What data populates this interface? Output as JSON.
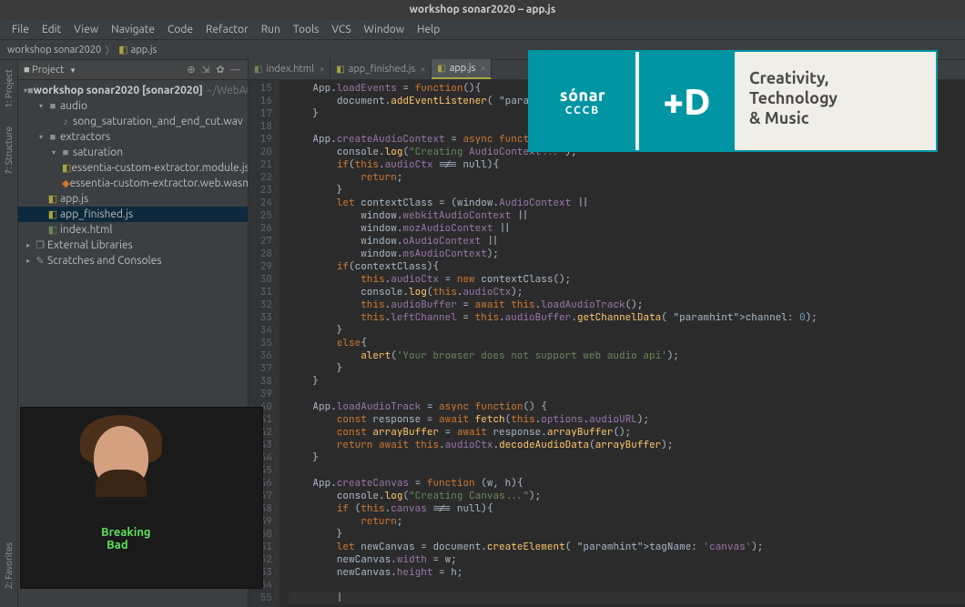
{
  "title": "workshop sonar2020 – app.js",
  "menu": [
    "File",
    "Edit",
    "View",
    "Navigate",
    "Code",
    "Refactor",
    "Run",
    "Tools",
    "VCS",
    "Window",
    "Help"
  ],
  "breadcrumb": {
    "project": "workshop sonar2020",
    "file": "app.js"
  },
  "leftbar": [
    "1: Project",
    "7: Structure",
    "2: Favorites"
  ],
  "project_panel": {
    "title": "Project"
  },
  "tree": [
    {
      "depth": 0,
      "caret": "▾",
      "icon": "dir",
      "label": "workshop sonar2020",
      "extra_bold": "[sonar2020]",
      "dim": "~/WebAudioPrj"
    },
    {
      "depth": 1,
      "caret": "▾",
      "icon": "dir",
      "label": "audio"
    },
    {
      "depth": 2,
      "caret": "",
      "icon": "wav",
      "label": "song_saturation_and_end_cut.wav"
    },
    {
      "depth": 1,
      "caret": "▾",
      "icon": "dir",
      "label": "extractors"
    },
    {
      "depth": 2,
      "caret": "▾",
      "icon": "dir",
      "label": "saturation"
    },
    {
      "depth": 3,
      "caret": "",
      "icon": "js",
      "label": "essentia-custom-extractor.module.js"
    },
    {
      "depth": 3,
      "caret": "",
      "icon": "wasm",
      "label": "essentia-custom-extractor.web.wasm"
    },
    {
      "depth": 1,
      "caret": "",
      "icon": "js",
      "label": "app.js"
    },
    {
      "depth": 1,
      "caret": "",
      "icon": "js",
      "label": "app_finished.js",
      "selected": true
    },
    {
      "depth": 1,
      "caret": "",
      "icon": "html",
      "label": "index.html"
    },
    {
      "depth": 0,
      "caret": "▸",
      "icon": "lib",
      "label": "External Libraries"
    },
    {
      "depth": 0,
      "caret": "▸",
      "icon": "scratch",
      "label": "Scratches and Consoles"
    }
  ],
  "tabs": [
    {
      "icon": "html",
      "label": "index.html",
      "active": false
    },
    {
      "icon": "js",
      "label": "app_finished.js",
      "active": false
    },
    {
      "icon": "js",
      "label": "app.js",
      "active": true
    }
  ],
  "gutter_start": 15,
  "code_lines": [
    "    App.loadEvents = function(){",
    "        document.addEventListener( type: 'click', this.c",
    "    }",
    "",
    "    App.createAudioContext = async function (){",
    "        console.log(\"Creating AudioContext...\");",
    "        if(this.audioCtx !== null){",
    "            return;",
    "        }",
    "        let contextClass = (window.AudioContext ||",
    "            window.webkitAudioContext ||",
    "            window.mozAudioContext ||",
    "            window.oAudioContext ||",
    "            window.msAudioContext);",
    "        if(contextClass){",
    "            this.audioCtx = new contextClass();",
    "            console.log(this.audioCtx);",
    "            this.audioBuffer = await this.loadAudioTrack();",
    "            this.leftChannel = this.audioBuffer.getChannelData( channel: 0);",
    "        }",
    "        else{",
    "            alert('Your browser does not support web audio api');",
    "        }",
    "    }",
    "",
    "    App.loadAudioTrack = async function() {",
    "        const response = await fetch(this.options.audioURL);",
    "        const arrayBuffer = await response.arrayBuffer();",
    "        return await this.audioCtx.decodeAudioData(arrayBuffer);",
    "    }",
    "",
    "    App.createCanvas = function (w, h){",
    "        console.log(\"Creating Canvas...\");",
    "        if (this.canvas !== null){",
    "            return;",
    "        }",
    "        let newCanvas = document.createElement( tagName: 'canvas');",
    "        newCanvas.width = w;",
    "        newCanvas.height = h;",
    "",
    "        |"
  ],
  "banner": {
    "sonar": "sónar",
    "cccb": "CCCB",
    "plusd": "+D",
    "tagline": "Creativity,\nTechnology\n& Music"
  },
  "webcam_logo": {
    "l1": "Breaking",
    "l2": "Bad"
  }
}
